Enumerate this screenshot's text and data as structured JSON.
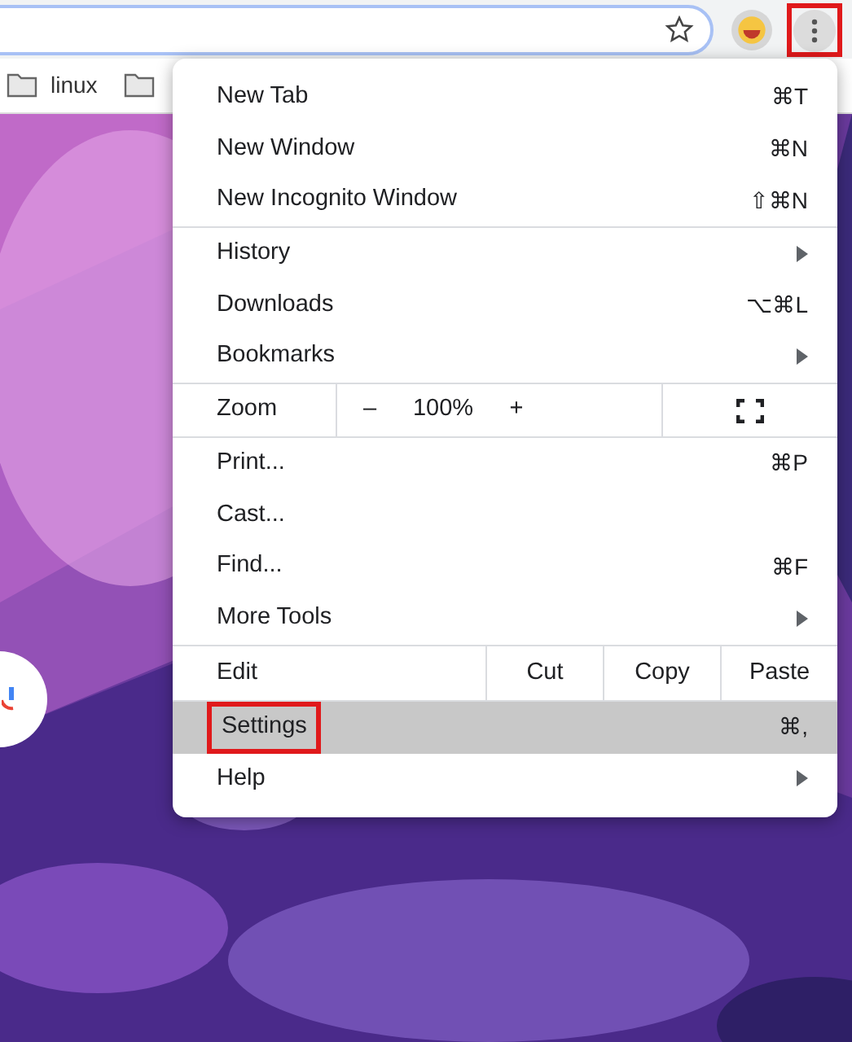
{
  "toolbar": {
    "menu_highlighted": true
  },
  "bookmarks": [
    {
      "kind": "labeled",
      "label": "linux"
    },
    {
      "kind": "folder"
    }
  ],
  "menu": {
    "sections": [
      [
        {
          "kind": "item",
          "label": "New Tab",
          "shortcut": "⌘T",
          "submenu": false,
          "selected": false,
          "highlighted": false
        },
        {
          "kind": "item",
          "label": "New Window",
          "shortcut": "⌘N",
          "submenu": false,
          "selected": false,
          "highlighted": false
        },
        {
          "kind": "item",
          "label": "New Incognito Window",
          "shortcut": "⇧⌘N",
          "submenu": false,
          "selected": false,
          "highlighted": false
        }
      ],
      [
        {
          "kind": "item",
          "label": "History",
          "submenu": true,
          "selected": false,
          "highlighted": false
        },
        {
          "kind": "item",
          "label": "Downloads",
          "shortcut": "⌥⌘L",
          "submenu": false,
          "selected": false,
          "highlighted": false
        },
        {
          "kind": "item",
          "label": "Bookmarks",
          "submenu": true,
          "selected": false,
          "highlighted": false
        }
      ],
      [
        {
          "kind": "zoom",
          "label": "Zoom",
          "minus": "–",
          "value": "100%",
          "plus": "+"
        }
      ],
      [
        {
          "kind": "item",
          "label": "Print...",
          "shortcut": "⌘P",
          "submenu": false,
          "selected": false,
          "highlighted": false
        },
        {
          "kind": "item",
          "label": "Cast...",
          "submenu": false,
          "selected": false,
          "highlighted": false
        },
        {
          "kind": "item",
          "label": "Find...",
          "shortcut": "⌘F",
          "submenu": false,
          "selected": false,
          "highlighted": false
        },
        {
          "kind": "item",
          "label": "More Tools",
          "submenu": true,
          "selected": false,
          "highlighted": false
        }
      ],
      [
        {
          "kind": "edit",
          "label": "Edit",
          "buttons": [
            "Cut",
            "Copy",
            "Paste"
          ]
        }
      ],
      [
        {
          "kind": "item",
          "label": "Settings",
          "shortcut": "⌘,",
          "submenu": false,
          "selected": true,
          "highlighted": true
        },
        {
          "kind": "item",
          "label": "Help",
          "submenu": true,
          "selected": false,
          "highlighted": false
        }
      ]
    ]
  }
}
